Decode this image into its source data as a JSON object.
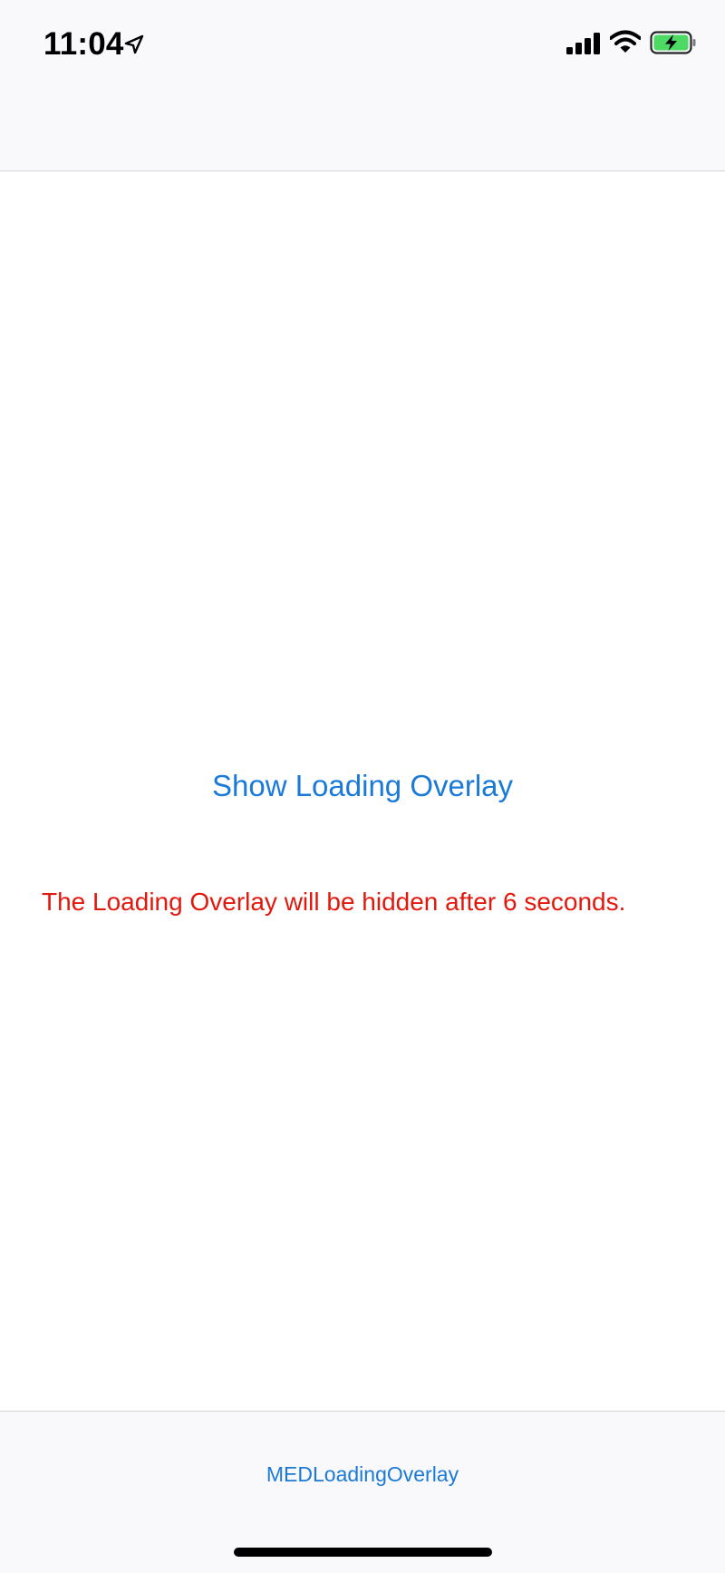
{
  "status_bar": {
    "time": "11:04",
    "icons": [
      "location-arrow-icon",
      "cellular-signal-icon",
      "wifi-icon",
      "battery-charging-icon"
    ],
    "battery_color": "#4cd964"
  },
  "main": {
    "show_button_label": "Show Loading Overlay",
    "message": "The Loading Overlay will be hidden after 6 seconds.",
    "accent_color": "#1a7ad9",
    "message_color": "#e2180d"
  },
  "tab_bar": {
    "items": [
      {
        "label": "MEDLoadingOverlay"
      }
    ]
  }
}
